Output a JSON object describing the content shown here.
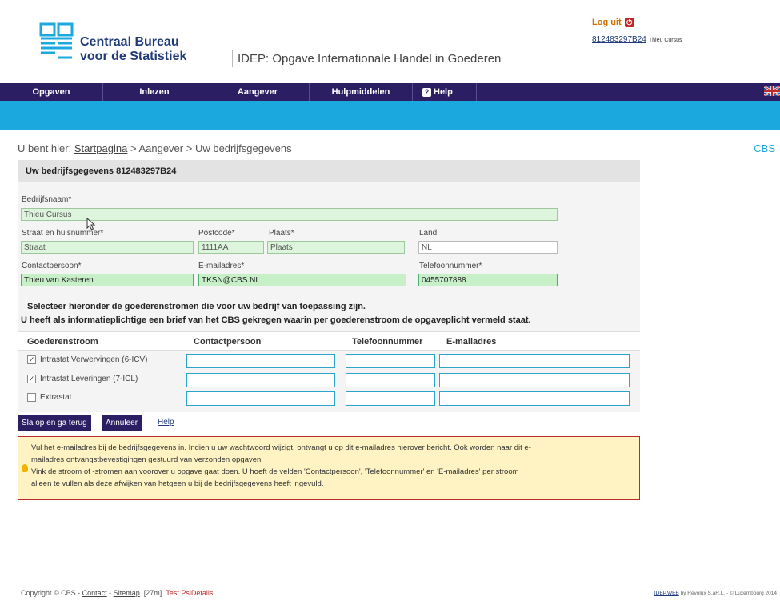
{
  "header": {
    "logo_line1": "Centraal Bureau",
    "logo_line2": "voor de Statistiek",
    "app_title": "IDEP: Opgave Internationale Handel in Goederen",
    "logout_label": "Log uit",
    "user_id": "812483297B24",
    "user_name": "Thieu Cursus"
  },
  "nav": {
    "items": [
      "Opgaven",
      "Inlezen",
      "Aangever",
      "Hulpmiddelen",
      "Help"
    ]
  },
  "breadcrumb": {
    "prefix": "U bent hier:",
    "home": "Startpagina",
    "sep1": ">",
    "level2": "Aangever",
    "sep2": ">",
    "current": "Uw bedrijfsgegevens",
    "right_label": "CBS"
  },
  "form": {
    "panel_title": "Uw bedrijfsgegevens 812483297B24",
    "company_label": "Bedrijfsnaam*",
    "company_value": "Thieu Cursus",
    "street_label": "Straat en huisnummer*",
    "street_value": "Straat",
    "postcode_label": "Postcode*",
    "postcode_value": "1111AA",
    "city_label": "Plaats*",
    "city_value": "Plaats",
    "country_label": "Land",
    "country_value": "NL",
    "contact_label": "Contactpersoon*",
    "contact_value": "Thieu van Kasteren",
    "email_label": "E-mailadres*",
    "email_value": "TKSN@CBS.NL",
    "phone_label": "Telefoonnummer*",
    "phone_value": "0455707888",
    "notice1": "Selecteer hieronder de goederenstromen die voor uw bedrijf van toepassing zijn.",
    "notice2": "U heeft als informatieplichtige een brief van het CBS gekregen waarin per goederenstroom de opgaveplicht vermeld staat."
  },
  "flows": {
    "headers": [
      "Goederenstroom",
      "Contactpersoon",
      "Telefoonnummer",
      "E-mailadres"
    ],
    "rows": [
      {
        "label": "Intrastat Verwervingen (6-ICV)",
        "checked": "✓"
      },
      {
        "label": "Intrastat Leveringen (7-ICL)",
        "checked": "✓"
      },
      {
        "label": "Extrastat",
        "checked": ""
      }
    ]
  },
  "actions": {
    "save_label": "Sla op en ga terug",
    "cancel_label": "Annuleer",
    "help_label": "Help"
  },
  "info": {
    "line1": "Vul het e-mailadres bij de bedrijfsgegevens in. Indien u uw wachtwoord wijzigt, ontvangt u op dit e-mailadres hierover bericht. Ook worden naar dit e-",
    "line2": "mailadres ontvangstbevestigingen gestuurd van verzonden opgaven.",
    "line3": "Vink de stroom of -stromen aan voorover u opgave gaat doen. U hoeft de velden 'Contactpersoon', 'Telefoonnummer' en 'E-mailadres' per stroom",
    "line4": "alleen te vullen als deze afwijken van hetgeen u bij de bedrijfsgegevens heeft ingevuld."
  },
  "footer": {
    "copyright": "Copyright © CBS -",
    "contact": "Contact",
    "dash": "-",
    "sitemap": "Sitemap",
    "timer": "[27m]",
    "test": "Test PsiDetails",
    "idep_web": "IDEP.WEB",
    "credit": "by Revolux S.àR.L. - © Luxembourg 2014"
  },
  "colors": {
    "nav_bg": "#2b1e63",
    "teal": "#1aa8df",
    "field_bg": "#dcf5dc",
    "info_bg": "#fff3c4",
    "info_border": "#c0292b"
  }
}
